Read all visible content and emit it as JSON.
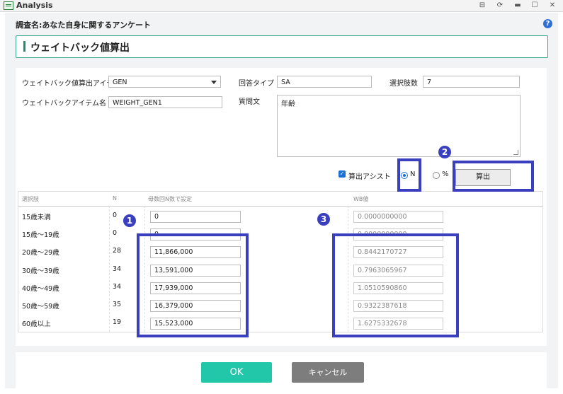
{
  "window": {
    "title": "Analysis"
  },
  "survey_name": "調査名:あなた自身に関するアンケート",
  "help_label": "?",
  "section_title": "ウェイトバック値算出",
  "form": {
    "item_label": "ウェイトバック値算出アイテム",
    "item_value": "GEN",
    "answer_type_label": "回答タイプ",
    "answer_type_value": "SA",
    "choices_label": "選択肢数",
    "choices_value": "7",
    "wb_item_label": "ウェイトバックアイテム名",
    "wb_item_value": "WEIGHT_GEN1",
    "question_label": "質問文",
    "question_value": "年齢"
  },
  "assist": {
    "checkbox_label": "算出アシスト",
    "radio_n_label": "N",
    "radio_pct_label": "%",
    "calc_button": "算出"
  },
  "table": {
    "headers": [
      "選択肢",
      "N",
      "母数回N数で設定",
      "WB値"
    ],
    "rows": [
      {
        "cat": "15歳未満",
        "n": "0",
        "pop": "0",
        "wb": "0.0000000000"
      },
      {
        "cat": "15歳～19歳",
        "n": "0",
        "pop": "0",
        "wb": "0.0000000000"
      },
      {
        "cat": "20歳～29歳",
        "n": "28",
        "pop": "11,866,000",
        "wb": "0.8442170727"
      },
      {
        "cat": "30歳～39歳",
        "n": "34",
        "pop": "13,591,000",
        "wb": "0.7963065967"
      },
      {
        "cat": "40歳～49歳",
        "n": "34",
        "pop": "17,939,000",
        "wb": "1.0510590860"
      },
      {
        "cat": "50歳～59歳",
        "n": "35",
        "pop": "16,379,000",
        "wb": "0.9322387618"
      },
      {
        "cat": "60歳以上",
        "n": "19",
        "pop": "15,523,000",
        "wb": "1.6275332678"
      }
    ]
  },
  "markers": [
    "1",
    "2",
    "3"
  ],
  "buttons": {
    "ok": "OK",
    "cancel": "キャンセル"
  }
}
